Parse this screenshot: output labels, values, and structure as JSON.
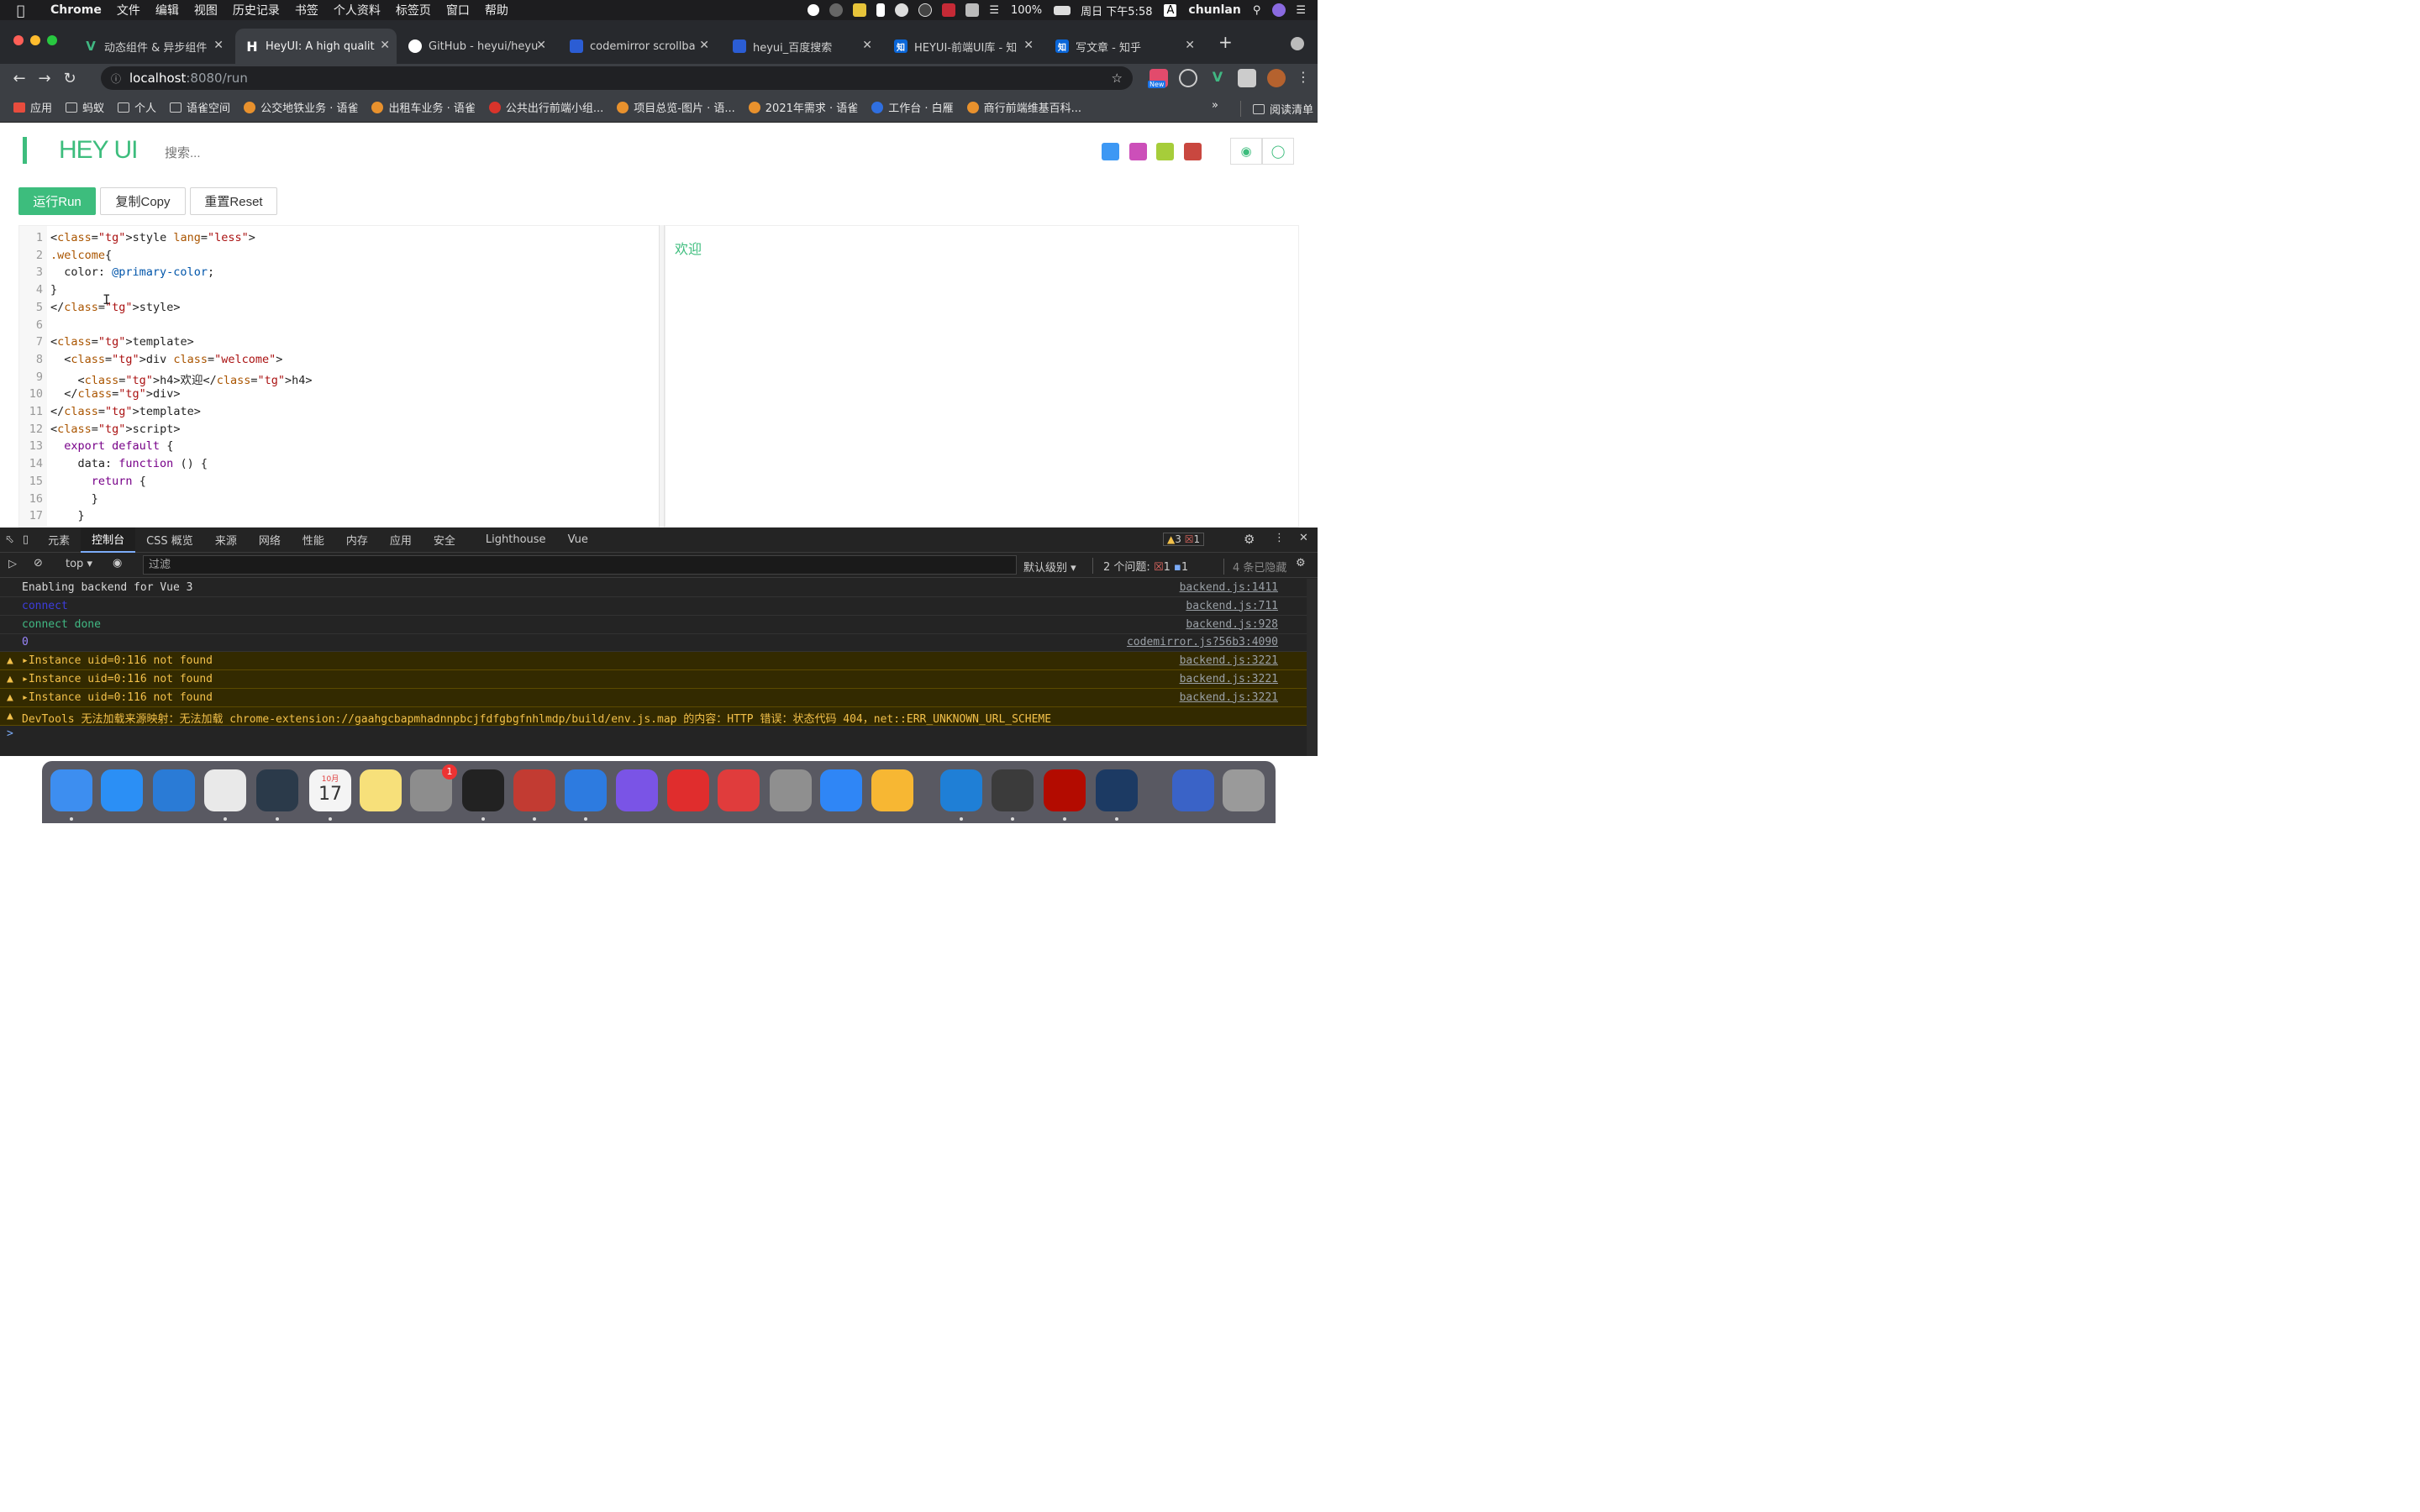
{
  "menubar": {
    "apple": "",
    "items": [
      "Chrome",
      "文件",
      "编辑",
      "视图",
      "历史记录",
      "书签",
      "个人资料",
      "标签页",
      "窗口",
      "帮助"
    ],
    "battery": "100%",
    "datetime": "周日 下午5:58",
    "input_method": "A",
    "user": "chunlan"
  },
  "tabs": [
    {
      "title": "动态组件 & 异步组件",
      "favicon": "V",
      "color": "#41b883"
    },
    {
      "title": "HeyUI: A high qualit",
      "favicon": "H",
      "color": "#3c3f44"
    },
    {
      "title": "GitHub - heyui/heyu",
      "favicon": "gh",
      "color": "#fff"
    },
    {
      "title": "codemirror scrollba",
      "favicon": "bd",
      "color": "#2b5dd4"
    },
    {
      "title": "heyui_百度搜索",
      "favicon": "bd",
      "color": "#2b5dd4"
    },
    {
      "title": "HEYUI-前端UI库 - 知",
      "favicon": "知",
      "color": "#0a66d8"
    },
    {
      "title": "写文章 - 知乎",
      "favicon": "知",
      "color": "#0a66d8"
    }
  ],
  "address": {
    "host": "localhost",
    "path": ":8080/run"
  },
  "ext_badge": "New",
  "bookmarks": [
    "应用",
    "蚂蚁",
    "个人",
    "语雀空间",
    "公交地铁业务 · 语雀",
    "出租车业务 · 语雀",
    "公共出行前端小组...",
    "项目总览-图片 · 语...",
    "2021年需求 · 语雀",
    "工作台 · 白雁",
    "商行前端维基百科..."
  ],
  "bookmarks_more": "»",
  "reading_list": "阅读清单",
  "page": {
    "logo": "HEY UI",
    "search_placeholder": "搜索...",
    "theme_colors": [
      "#3d98f4",
      "#cc4fb9",
      "#a6cd3a",
      "#c9473f"
    ],
    "buttons": {
      "run": "运行Run",
      "copy": "复制Copy",
      "reset": "重置Reset"
    },
    "preview_text": "欢迎"
  },
  "code_lines": [
    {
      "n": "1",
      "text": "<style lang=\"less\">"
    },
    {
      "n": "2",
      "text": ".welcome{"
    },
    {
      "n": "3",
      "text": "  color: @primary-color;"
    },
    {
      "n": "4",
      "text": "}"
    },
    {
      "n": "5",
      "text": "</style>"
    },
    {
      "n": "6",
      "text": ""
    },
    {
      "n": "7",
      "text": "<template>"
    },
    {
      "n": "8",
      "text": "  <div class=\"welcome\">"
    },
    {
      "n": "9",
      "text": "    <h4>欢迎</h4>"
    },
    {
      "n": "10",
      "text": "  </div>"
    },
    {
      "n": "11",
      "text": "</template>"
    },
    {
      "n": "12",
      "text": "<script>"
    },
    {
      "n": "13",
      "text": "  export default {"
    },
    {
      "n": "14",
      "text": "    data: function () {"
    },
    {
      "n": "15",
      "text": "      return {"
    },
    {
      "n": "16",
      "text": "      }"
    },
    {
      "n": "17",
      "text": "    }"
    }
  ],
  "devtools": {
    "tabs": [
      "元素",
      "控制台",
      "CSS 概览",
      "来源",
      "网络",
      "性能",
      "内存",
      "应用",
      "安全",
      "Lighthouse",
      "Vue"
    ],
    "warnings": "3",
    "errors": "1",
    "context": "top",
    "filter_placeholder": "过滤",
    "level": "默认级别",
    "issues_label": "2 个问题:",
    "issues_err": "1",
    "issues_info": "1",
    "hidden": "4 条已隐藏",
    "logs": [
      {
        "msg": "Enabling backend for Vue 3",
        "src": "backend.js:1411",
        "type": "log"
      },
      {
        "msg": "connect",
        "src": "backend.js:711",
        "type": "log"
      },
      {
        "msg": "connect done",
        "src": "backend.js:928",
        "type": "log"
      },
      {
        "msg": "0",
        "src": "codemirror.js?56b3:4090",
        "type": "log"
      },
      {
        "msg": "Instance uid=0:116 not found",
        "src": "backend.js:3221",
        "type": "warn"
      },
      {
        "msg": "Instance uid=0:116 not found",
        "src": "backend.js:3221",
        "type": "warn"
      },
      {
        "msg": "Instance uid=0:116 not found",
        "src": "backend.js:3221",
        "type": "warn"
      },
      {
        "msg": "DevTools 无法加载来源映射：无法加载 chrome-extension://gaahgcbapmhadnnpbcjfdfgbgfnhlmdp/build/env.js.map 的内容：HTTP 错误：状态代码 404，net::ERR_UNKNOWN_URL_SCHEME",
        "src": "",
        "type": "warn"
      }
    ],
    "prompt": ">"
  },
  "dock": {
    "calendar_month": "10月",
    "calendar_day": "17",
    "badge": "1",
    "apps": [
      "finder",
      "feishu",
      "vscode",
      "chrome",
      "devtool",
      "calendar",
      "notes",
      "system-preferences",
      "terminal",
      "antman",
      "xcode-simulator",
      "safari",
      "netease-music",
      "ting",
      "rocket",
      "shield",
      "sketch",
      "eudic",
      "phone",
      "acrobat",
      "quicktime",
      "files",
      "trash"
    ]
  }
}
